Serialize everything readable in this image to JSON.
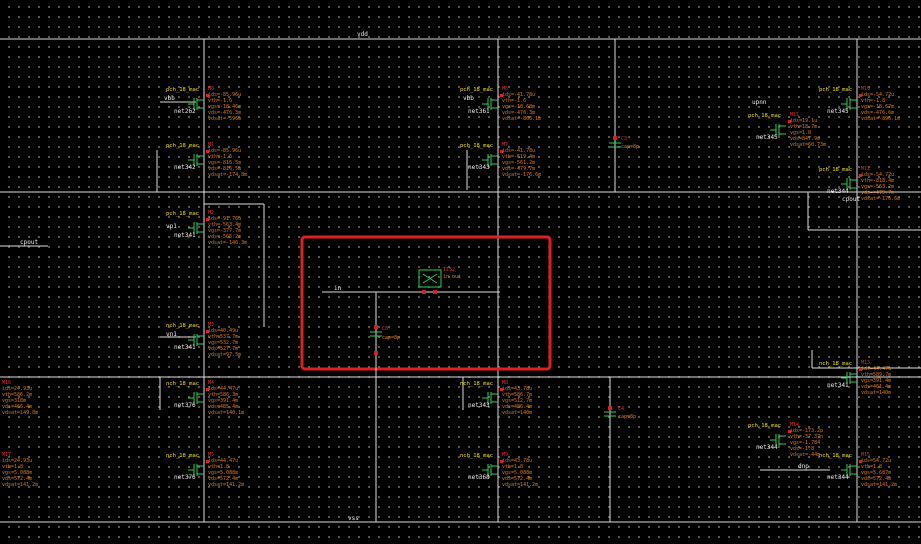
{
  "nets": {
    "vdd": "vdd",
    "vss": "vss",
    "in": "in",
    "upnn": "upnn",
    "dnp": "dnp",
    "cpout": "cpout",
    "vp1": "vp1",
    "vn1": "vn1",
    "vbb": "vbb"
  },
  "capacitors": [
    {
      "inst": "C0",
      "value": "cap=8p"
    },
    {
      "inst": "C3",
      "value": "cap=8p"
    },
    {
      "inst": "C4",
      "value": "cap=8p"
    }
  ],
  "buffer": {
    "inst": "I152",
    "pins": "in  out"
  },
  "highlight_color": "#e02020",
  "devices": [
    {
      "id": "m0",
      "cell": "pch_18_mac",
      "inst": "M0",
      "net": "net262",
      "p": [
        "ids=-85.96u",
        "vth=-1.6",
        "vgs=-18.46m",
        "vds=-476.3m",
        "vdsat=-596m"
      ]
    },
    {
      "id": "m1",
      "cell": "pch_18_mac",
      "inst": "M1",
      "net": "net342",
      "p": [
        "ids=-85.96u",
        "vth=-1.6",
        "vgs=-816.5m",
        "vds=-816.5m",
        "vdsat=-174.8m"
      ]
    },
    {
      "id": "m2",
      "cell": "pch_18_mac",
      "inst": "M2",
      "net": "net341",
      "p": [
        "ids=-91.76u",
        "vth=-563.4m",
        "vgs=-377.7m",
        "vds=-565.2m",
        "vdsat=-146.3m"
      ]
    },
    {
      "id": "m3",
      "cell": "nch_18_mac",
      "inst": "M3",
      "net": "net341",
      "p": [
        "ids=40.49u",
        "vth=537.7m",
        "vgs=532.7m",
        "vds=527.7m",
        "vdsat=97.5m"
      ]
    },
    {
      "id": "m4",
      "cell": "nch_18_mac",
      "inst": "M4",
      "net": "net376",
      "p": [
        "ids=44.47u",
        "vth=586.3m",
        "vgs=391.4m",
        "vds=485.4m",
        "vdsat=140.1m"
      ]
    },
    {
      "id": "m5",
      "cell": "nch_18_mac",
      "inst": "M5",
      "net": "net376",
      "p": [
        "ids=44.47u",
        "vth=1.8",
        "vgs=5.088m",
        "vds=572.4m",
        "vdsat=141.2m"
      ]
    },
    {
      "id": "m6",
      "cell": "pch_18_mac",
      "inst": "M6",
      "net": "net361",
      "p": [
        "ids=-41.78u",
        "vth=-1.6",
        "vgs=-18.68m",
        "vds=-476.3m",
        "vdsat=-866.1m"
      ]
    },
    {
      "id": "m7",
      "cell": "pch_18_mac",
      "inst": "M7",
      "net": "net343",
      "p": [
        "ids=-41.78u",
        "vth=-619.4m",
        "vgs=-561.2m",
        "vds=-479.7m",
        "vdsat=-176.6m"
      ]
    },
    {
      "id": "m8",
      "cell": "nch_18_mac",
      "inst": "M8",
      "net": "net343",
      "p": [
        "ids=43.78u",
        "vth=586.7m",
        "vgs=512.7m",
        "vds=486.4m",
        "vdsat=140m"
      ]
    },
    {
      "id": "m9",
      "cell": "nch_18_mac",
      "inst": "M9",
      "net": "net368",
      "p": [
        "ids=43.78u",
        "vth=1.8",
        "vgs=5.088m",
        "vds=572.4m",
        "vdsat=141.2m"
      ]
    },
    {
      "id": "m10",
      "cell": "pch_18_mac",
      "inst": "M10",
      "net": "net345",
      "p": [
        "ids=-54.72u",
        "vth=-1.8",
        "vgs=-18.67m",
        "vds=-476.6m",
        "vdsat=-896.1m"
      ]
    },
    {
      "id": "m11",
      "cell": "nch_18_mac",
      "inst": "M11",
      "net": "net345",
      "p": [
        "ids=19.1u",
        "vth=18.7m",
        "vgs=1.8",
        "vds=847.9m",
        "vdsat=60.73m"
      ]
    },
    {
      "id": "m12",
      "cell": "pch_18_mac",
      "inst": "M12",
      "net": "net344",
      "p": [
        "ids=-54.72u",
        "vth=-818.4m",
        "vgs=-563.2m",
        "vds=-479.7m",
        "vdsat=-176.6m"
      ]
    },
    {
      "id": "m13",
      "cell": "nch_18_mac",
      "inst": "M13",
      "net": "net341",
      "p": [
        "ids=44.47u",
        "vth=589.7m",
        "vgs=391.4m",
        "vds=461.4m",
        "vdsat=140m"
      ]
    },
    {
      "id": "m14",
      "cell": "pch_18_mac",
      "inst": "M14",
      "net": "net344",
      "p": [
        "ids=-173.2p",
        "vth=-37.37n",
        "vgs=-1.784",
        "vds=-1.8",
        "vdsat=-44m"
      ]
    },
    {
      "id": "m15",
      "cell": "nch_18_mac",
      "inst": "M15",
      "net": "net344",
      "p": [
        "ids=54.72u",
        "vth=1.8",
        "vgs=5.687m",
        "vds=572.4m",
        "vdsat=141.2m"
      ]
    },
    {
      "id": "m16",
      "cell": "nch_18_mac",
      "inst": "M16",
      "net": "net376",
      "p": [
        "ids=24.93u",
        "vth=586.2m",
        "vgs=318m",
        "vds=466.4m",
        "vdsat=149.8m"
      ]
    },
    {
      "id": "m17",
      "cell": "nch_18_mac",
      "inst": "M17",
      "net": "net376",
      "p": [
        "ids=24.93u",
        "vth=1.8",
        "vgs=5.088m",
        "vds=572.4m",
        "vdsat=141.2m"
      ]
    }
  ]
}
